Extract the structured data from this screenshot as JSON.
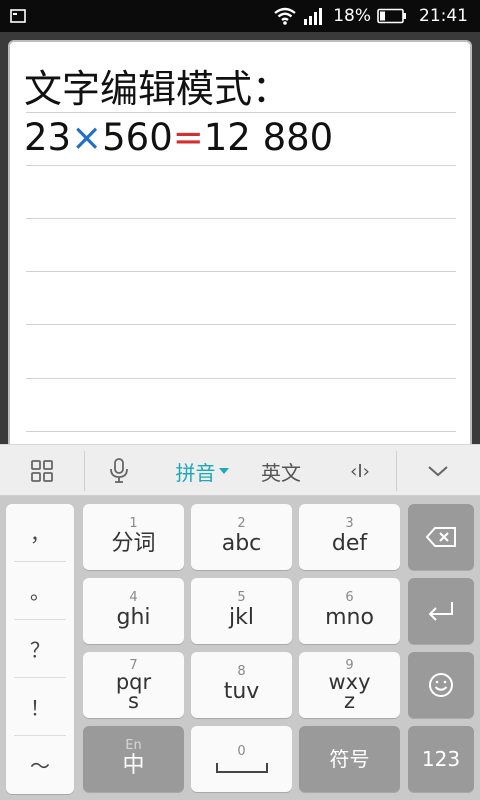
{
  "status_bar": {
    "battery_percent": "18%",
    "time": "21:41",
    "icons": [
      "notification-square-icon",
      "wifi-icon",
      "signal-icon",
      "battery-icon"
    ]
  },
  "note": {
    "title": "文字编辑模式：",
    "equation": {
      "left": "23",
      "times": "×",
      "middle": "560",
      "equals": "=",
      "result": "12 880"
    }
  },
  "ime_toolbar": {
    "pinyin_label": "拼音",
    "english_label": "英文",
    "cursor_label": "‹I›",
    "icons": [
      "grid-icon",
      "microphone-icon",
      "cursor-icon",
      "chevron-down-icon"
    ]
  },
  "keyboard": {
    "punctuation": [
      "，",
      "。",
      "？",
      "！",
      "～"
    ],
    "keys": [
      {
        "num": "1",
        "label": "分词"
      },
      {
        "num": "2",
        "label": "abc"
      },
      {
        "num": "3",
        "label": "def"
      },
      {
        "num": "4",
        "label": "ghi"
      },
      {
        "num": "5",
        "label": "jkl"
      },
      {
        "num": "6",
        "label": "mno"
      },
      {
        "num": "7",
        "label_a": "pqr",
        "label_b": "s"
      },
      {
        "num": "8",
        "label": "tuv"
      },
      {
        "num": "9",
        "label_a": "wxy",
        "label_b": "z"
      }
    ],
    "bottom": {
      "lang_small": "En",
      "lang_main": "中",
      "space_num": "0",
      "symbols": "符号",
      "numbers": "123"
    },
    "side_icons": [
      "backspace-icon",
      "enter-icon",
      "emoji-icon"
    ]
  }
}
